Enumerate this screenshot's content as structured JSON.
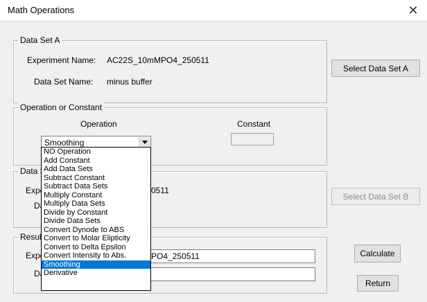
{
  "window": {
    "title": "Math Operations",
    "close_glyph": "✕"
  },
  "data_set_a": {
    "legend": "Data Set A",
    "experiment_label": "Experiment Name:",
    "experiment_value": "AC22S_10mMPO4_250511",
    "dataset_label": "Data Set Name:",
    "dataset_value": "minus buffer",
    "select_button": "Select Data Set A"
  },
  "operation_group": {
    "legend": "Operation or Constant",
    "operation_header": "Operation",
    "constant_header": "Constant",
    "selected_operation": "Smoothing",
    "constant_value": "",
    "options": [
      "NO Operation",
      "Add Constant",
      "Add Data Sets",
      "Subtract Constant",
      "Subtract Data Sets",
      "Multiply Constant",
      "Multiply Data Sets",
      "Divide by Constant",
      "Divide Data Sets",
      "Convert Dynode to ABS",
      "Convert to Molar Elipticity",
      "Convert to Delta Epsilon",
      "Convert Intensity to Abs.",
      "Smoothing",
      "Derivative"
    ],
    "highlighted_index": 13
  },
  "data_set_b": {
    "legend_visible": "Data S",
    "experiment_label_visible": "Expe",
    "experiment_value_visible": "0511",
    "dataset_label_visible": "Da",
    "select_button": "Select Data Set B"
  },
  "result": {
    "legend_visible": "Resul",
    "experiment_label_visible": "Expe",
    "experiment_value_visible": "PO4_250511",
    "dataset_label_visible": "Da",
    "dataset_value": ""
  },
  "buttons": {
    "calculate": "Calculate",
    "return": "Return"
  },
  "colors": {
    "selection": "#0078d7",
    "dialog_bg": "#f0f0f0"
  }
}
